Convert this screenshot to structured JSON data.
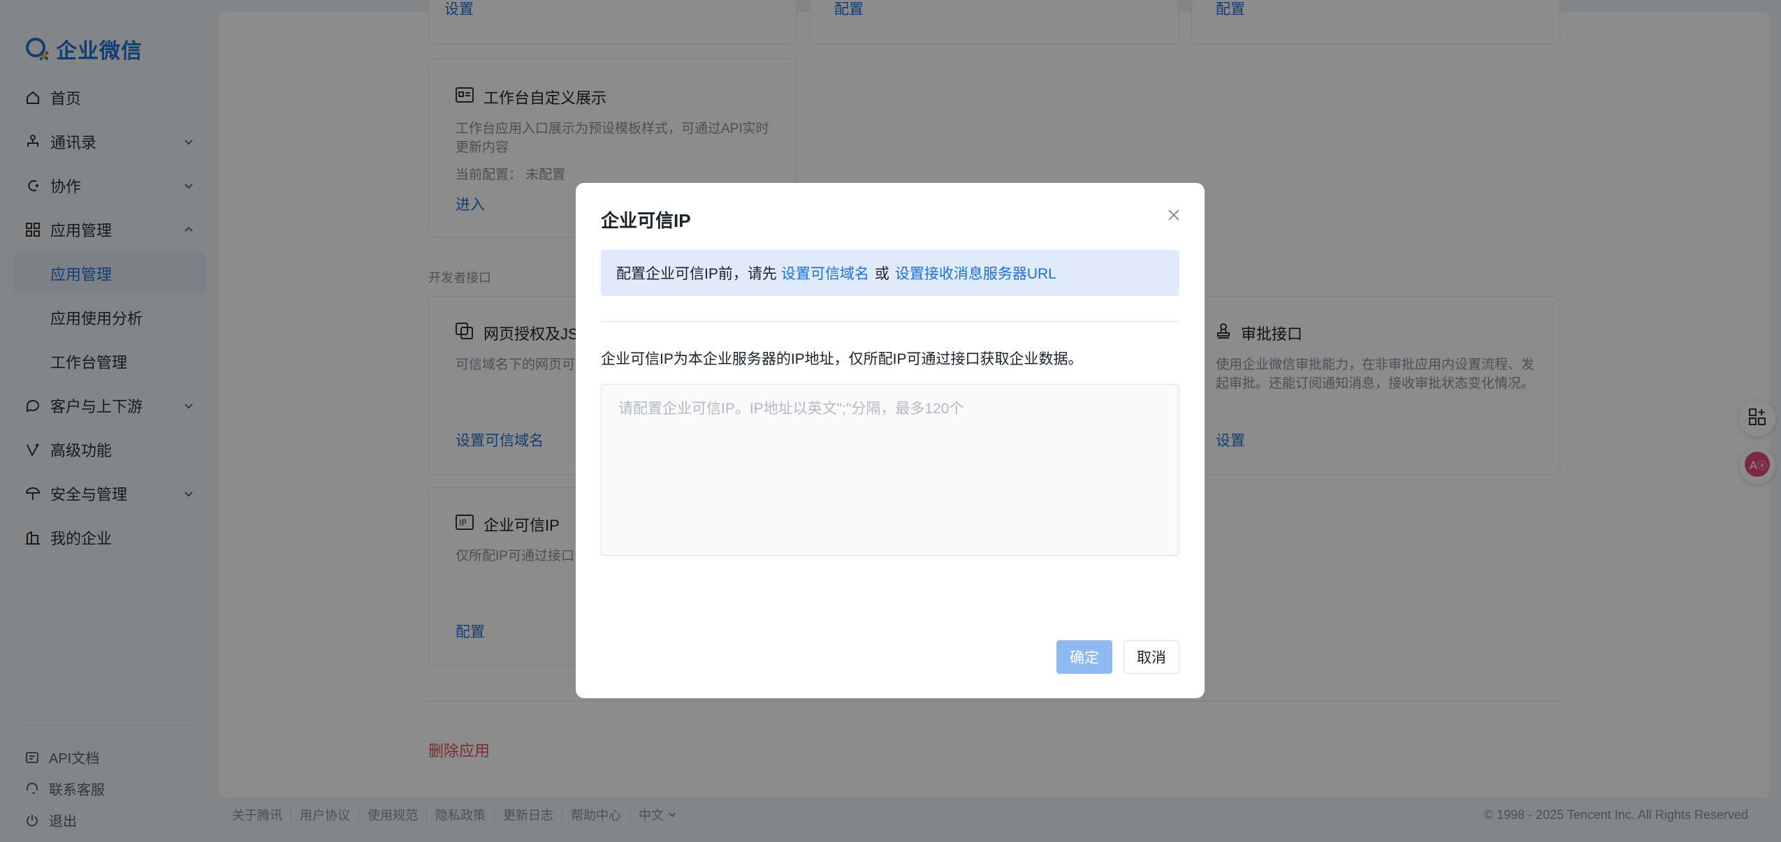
{
  "app": {
    "logo_text": "企业微信",
    "brand_color": "#1f6fd6"
  },
  "sidebar": {
    "items": [
      {
        "label": "首页",
        "icon": "home-icon"
      },
      {
        "label": "通讯录",
        "icon": "org-chart-icon"
      },
      {
        "label": "协作",
        "icon": "collaboration-icon"
      },
      {
        "label": "应用管理",
        "icon": "apps-grid-icon"
      },
      {
        "label": "应用管理"
      },
      {
        "label": "应用使用分析"
      },
      {
        "label": "工作台管理"
      },
      {
        "label": "客户与上下游",
        "icon": "chat-bubble-icon"
      },
      {
        "label": "高级功能",
        "icon": "advanced-icon"
      },
      {
        "label": "安全与管理",
        "icon": "umbrella-icon"
      },
      {
        "label": "我的企业",
        "icon": "building-icon"
      }
    ],
    "bottom": [
      {
        "label": "API文档",
        "icon": "api-doc-icon"
      },
      {
        "label": "联系客服",
        "icon": "headset-icon"
      },
      {
        "label": "退出",
        "icon": "power-icon"
      }
    ]
  },
  "main": {
    "top_links": [
      "设置",
      "配置",
      "配置"
    ],
    "workbench_card": {
      "title": "工作台自定义展示",
      "desc": "工作台应用入口展示为预设模板样式，可通过API实时更新内容",
      "meta_label": "当前配置：",
      "meta_value": "未配置",
      "link": "进入"
    },
    "dev_section_label": "开发者接口",
    "web_auth_card": {
      "title": "网页授权及JS-",
      "desc": "可信域名下的网页可",
      "link": "设置可信域名"
    },
    "approval_card": {
      "title": "审批接口",
      "desc": "使用企业微信审批能力，在非审批应用内设置流程、发起审批。还能订阅通知消息，接收审批状态变化情况。",
      "link": "设置"
    },
    "trusted_ip_card": {
      "title": "企业可信IP",
      "desc": "仅所配IP可通过接口",
      "link": "配置"
    },
    "delete_link": "删除应用"
  },
  "footer": {
    "links": [
      "关于腾讯",
      "用户协议",
      "使用规范",
      "隐私政策",
      "更新日志",
      "帮助中心",
      "中文"
    ],
    "copyright": "© 1998 - 2025 Tencent Inc. All Rights Reserved"
  },
  "modal": {
    "title": "企业可信IP",
    "notice_prefix": "配置企业可信IP前，请先",
    "notice_link1": "设置可信域名",
    "notice_or": "或",
    "notice_link2": "设置接收消息服务器URL",
    "description": "企业可信IP为本企业服务器的IP地址，仅所配IP可通过接口获取企业数据。",
    "input_placeholder": "请配置企业可信IP。IP地址以英文\";\"分隔，最多120个",
    "input_value": "",
    "ok_label": "确定",
    "cancel_label": "取消"
  }
}
